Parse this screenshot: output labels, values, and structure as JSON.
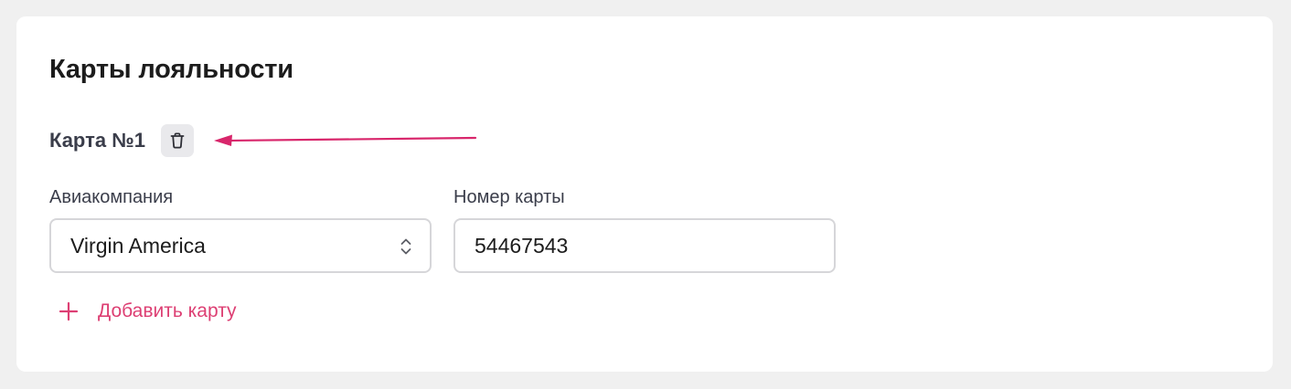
{
  "section": {
    "title": "Карты лояльности"
  },
  "loyalty_card": {
    "label": "Карта №1",
    "delete_icon": "trash-icon"
  },
  "fields": {
    "airline": {
      "label": "Авиакомпания",
      "value": "Virgin America",
      "icon": "chevron-up-down-icon"
    },
    "card_number": {
      "label": "Номер карты",
      "value": "54467543"
    }
  },
  "actions": {
    "add_card_label": "Добавить карту",
    "add_icon": "plus-icon"
  },
  "colors": {
    "accent": "#dd3f73",
    "annotation_arrow": "#d8266b",
    "page_background": "#f0f0f0",
    "card_background": "#ffffff",
    "field_border": "#d6d6d9",
    "delete_button_background": "#e9e9ec"
  }
}
